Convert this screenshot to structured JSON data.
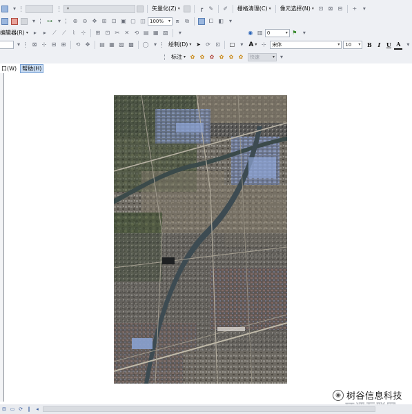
{
  "toolbar": {
    "vectorize_label": "矢量化(Z)",
    "raster_cleanup_label": "栅格清理(C)",
    "cell_select_label": "像元选择(N)",
    "editor_label": "编辑器(R)",
    "zoom_value": "100%",
    "layer_offset_value": "0",
    "draw_label": "绘制(D)",
    "text_tool_label": "A",
    "font_name": "宋体",
    "font_size": "10",
    "bold_label": "B",
    "italic_label": "I",
    "underline_label": "U",
    "annotation_label": "标注",
    "fast_label": "快速"
  },
  "menu": {
    "window_label": "口(W)",
    "help_label": "帮助(H)"
  },
  "watermark": {
    "line1": "树谷信息科技",
    "line2": "环评互联网"
  },
  "colors": {
    "toolbar_bg": "#eef0f4",
    "active_tab_bg": "#c8dcf3",
    "accent": "#3b5fa0"
  }
}
